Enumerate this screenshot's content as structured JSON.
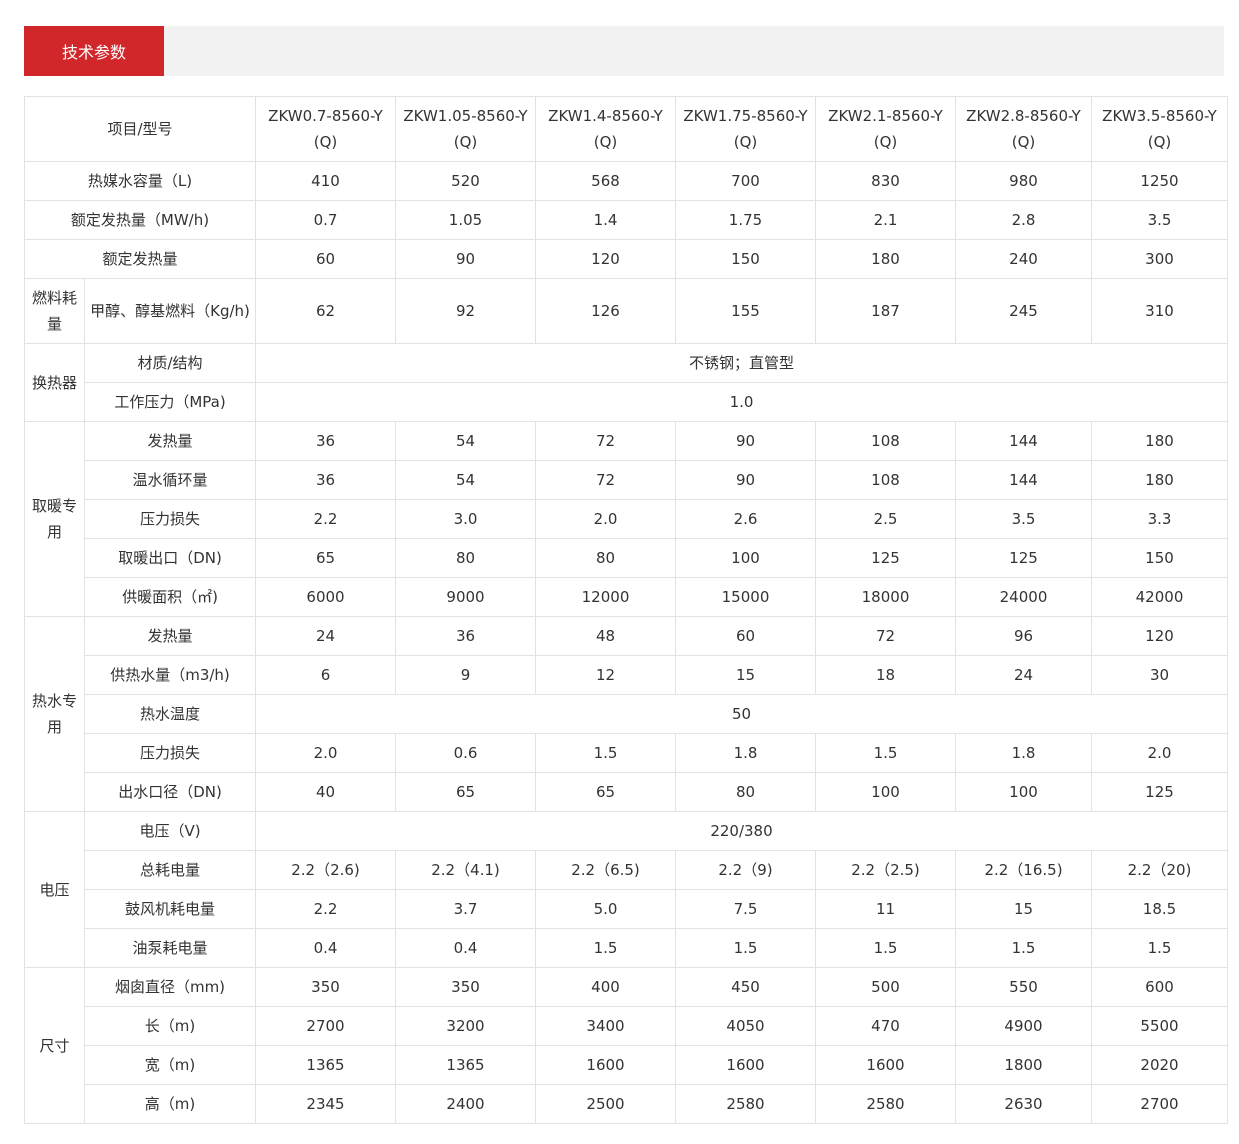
{
  "header": {
    "title": "技术参数"
  },
  "table": {
    "corner_label": "项目/型号",
    "models": [
      "ZKW0.7-8560-Y(Q)",
      "ZKW1.05-8560-Y(Q)",
      "ZKW1.4-8560-Y(Q)",
      "ZKW1.75-8560-Y(Q)",
      "ZKW2.1-8560-Y(Q)",
      "ZKW2.8-8560-Y(Q)",
      "ZKW3.5-8560-Y(Q)"
    ],
    "groups": [
      {
        "label": "",
        "rows": [
          {
            "label": "热媒水容量（L)",
            "values": [
              "410",
              "520",
              "568",
              "700",
              "830",
              "980",
              "1250"
            ]
          },
          {
            "label": "额定发热量（MW/h)",
            "values": [
              "0.7",
              "1.05",
              "1.4",
              "1.75",
              "2.1",
              "2.8",
              "3.5"
            ]
          },
          {
            "label": "额定发热量",
            "values": [
              "60",
              "90",
              "120",
              "150",
              "180",
              "240",
              "300"
            ]
          }
        ]
      },
      {
        "label": "燃料耗量",
        "rows": [
          {
            "label": "甲醇、醇基燃料（Kg/h)",
            "values": [
              "62",
              "92",
              "126",
              "155",
              "187",
              "245",
              "310"
            ]
          }
        ]
      },
      {
        "label": "换热器",
        "rows": [
          {
            "label": "材质/结构",
            "merged": "不锈钢；直管型"
          },
          {
            "label": "工作压力（MPa)",
            "merged": "1.0"
          }
        ]
      },
      {
        "label": "取暖专用",
        "rows": [
          {
            "label": "发热量",
            "values": [
              "36",
              "54",
              "72",
              "90",
              "108",
              "144",
              "180"
            ]
          },
          {
            "label": "温水循环量",
            "values": [
              "36",
              "54",
              "72",
              "90",
              "108",
              "144",
              "180"
            ]
          },
          {
            "label": "压力损失",
            "values": [
              "2.2",
              "3.0",
              "2.0",
              "2.6",
              "2.5",
              "3.5",
              "3.3"
            ]
          },
          {
            "label": "取暖出口（DN)",
            "values": [
              "65",
              "80",
              "80",
              "100",
              "125",
              "125",
              "150"
            ]
          },
          {
            "label": "供暖面积（㎡)",
            "values": [
              "6000",
              "9000",
              "12000",
              "15000",
              "18000",
              "24000",
              "42000"
            ]
          }
        ]
      },
      {
        "label": "热水专用",
        "rows": [
          {
            "label": "发热量",
            "values": [
              "24",
              "36",
              "48",
              "60",
              "72",
              "96",
              "120"
            ]
          },
          {
            "label": "供热水量（m3/h)",
            "values": [
              "6",
              "9",
              "12",
              "15",
              "18",
              "24",
              "30"
            ]
          },
          {
            "label": "热水温度",
            "merged": "50"
          },
          {
            "label": "压力损失",
            "values": [
              "2.0",
              "0.6",
              "1.5",
              "1.8",
              "1.5",
              "1.8",
              "2.0"
            ]
          },
          {
            "label": "出水口径（DN)",
            "values": [
              "40",
              "65",
              "65",
              "80",
              "100",
              "100",
              "125"
            ]
          }
        ]
      },
      {
        "label": "电压",
        "rows": [
          {
            "label": "电压（V)",
            "merged": "220/380"
          },
          {
            "label": "总耗电量",
            "values": [
              "2.2（2.6)",
              "2.2（4.1)",
              "2.2（6.5)",
              "2.2（9)",
              "2.2（2.5)",
              "2.2（16.5)",
              "2.2（20)"
            ]
          },
          {
            "label": "鼓风机耗电量",
            "values": [
              "2.2",
              "3.7",
              "5.0",
              "7.5",
              "11",
              "15",
              "18.5"
            ]
          },
          {
            "label": "油泵耗电量",
            "values": [
              "0.4",
              "0.4",
              "1.5",
              "1.5",
              "1.5",
              "1.5",
              "1.5"
            ]
          }
        ]
      },
      {
        "label": "尺寸",
        "rows": [
          {
            "label": "烟囱直径（mm)",
            "values": [
              "350",
              "350",
              "400",
              "450",
              "500",
              "550",
              "600"
            ]
          },
          {
            "label": "长（m)",
            "values": [
              "2700",
              "3200",
              "3400",
              "4050",
              "470",
              "4900",
              "5500"
            ]
          },
          {
            "label": "宽（m)",
            "values": [
              "1365",
              "1365",
              "1600",
              "1600",
              "1600",
              "1800",
              "2020"
            ]
          },
          {
            "label": "高（m)",
            "values": [
              "2345",
              "2400",
              "2500",
              "2580",
              "2580",
              "2630",
              "2700"
            ]
          }
        ]
      }
    ]
  }
}
